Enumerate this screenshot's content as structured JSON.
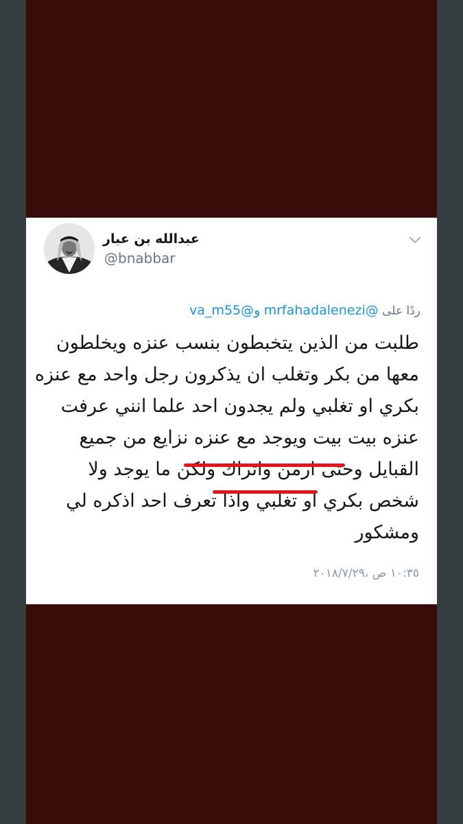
{
  "colors": {
    "page_background": "#343d3f",
    "stage_background": "#3a0c09",
    "card_background": "#ffffff",
    "link_blue": "#1b95e0",
    "secondary_gray": "#657786",
    "underline_red": "#e0141a"
  },
  "tweet": {
    "display_name": "عبدالله بن عبار",
    "handle": "@bnabbar",
    "menu_icon": "chevron-down-icon",
    "avatar_icon": "avatar",
    "reply": {
      "prefix": "ردًا على",
      "mention_1": "@mrfahadalenezi",
      "conjunction": "و",
      "mention_2": "@va_m55"
    },
    "lines": [
      "طلبت من الذين يتخبطون بنسب عنزه ويخلطون",
      "معها من بكر وتغلب ان يذكرون رجل واحد مع عنزه",
      "بكري او تغلبي ولم يجدون احد علما انني عرفت",
      "عنزه بيت بيت ويوجد مع عنزه نزايع من جميع",
      "القبايل وحتى ارمن واتراك ولكن ما يوجد ولا",
      "شخص بكري او تغلبي واذا تعرف احد اذكره لي",
      "ومشكور"
    ],
    "timestamp": "١٠:٣٥ ص ،٢٠١٨/٧/٢٩"
  }
}
